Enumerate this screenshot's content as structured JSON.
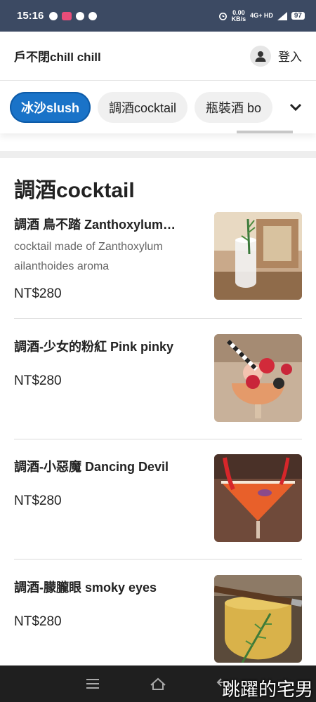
{
  "status_bar": {
    "time": "15:16",
    "net_speed": "0.00",
    "net_unit": "KB/s",
    "network": "4G+ HD",
    "battery": "97"
  },
  "header": {
    "store_name": "戶不閉chill chill",
    "login_label": "登入",
    "avatar_icon": "person-icon"
  },
  "tabs": [
    {
      "label": "冰沙slush",
      "active": true
    },
    {
      "label": "調酒cocktail",
      "active": false
    },
    {
      "label": "瓶裝酒 bo",
      "active": false
    }
  ],
  "section": {
    "title": "調酒cocktail"
  },
  "items": [
    {
      "name": "調酒 鳥不踏 Zanthoxylum…",
      "desc": "cocktail made of Zanthoxylum ailanthoides aroma",
      "price": "NT$280"
    },
    {
      "name": "調酒-少女的粉紅 Pink pinky",
      "desc": "",
      "price": "NT$280"
    },
    {
      "name": "調酒-小惡魔 Dancing Devil",
      "desc": "",
      "price": "NT$280"
    },
    {
      "name": "調酒-朦朧眼 smoky eyes",
      "desc": "",
      "price": "NT$280"
    }
  ],
  "navbar": {
    "icons": [
      "menu-icon",
      "home-icon",
      "back-icon"
    ]
  },
  "watermark": "跳躍的宅男",
  "colors": {
    "status_bar": "#3c4a63",
    "accent": "#1a73c8",
    "nav_bar": "#1f1f1f"
  }
}
